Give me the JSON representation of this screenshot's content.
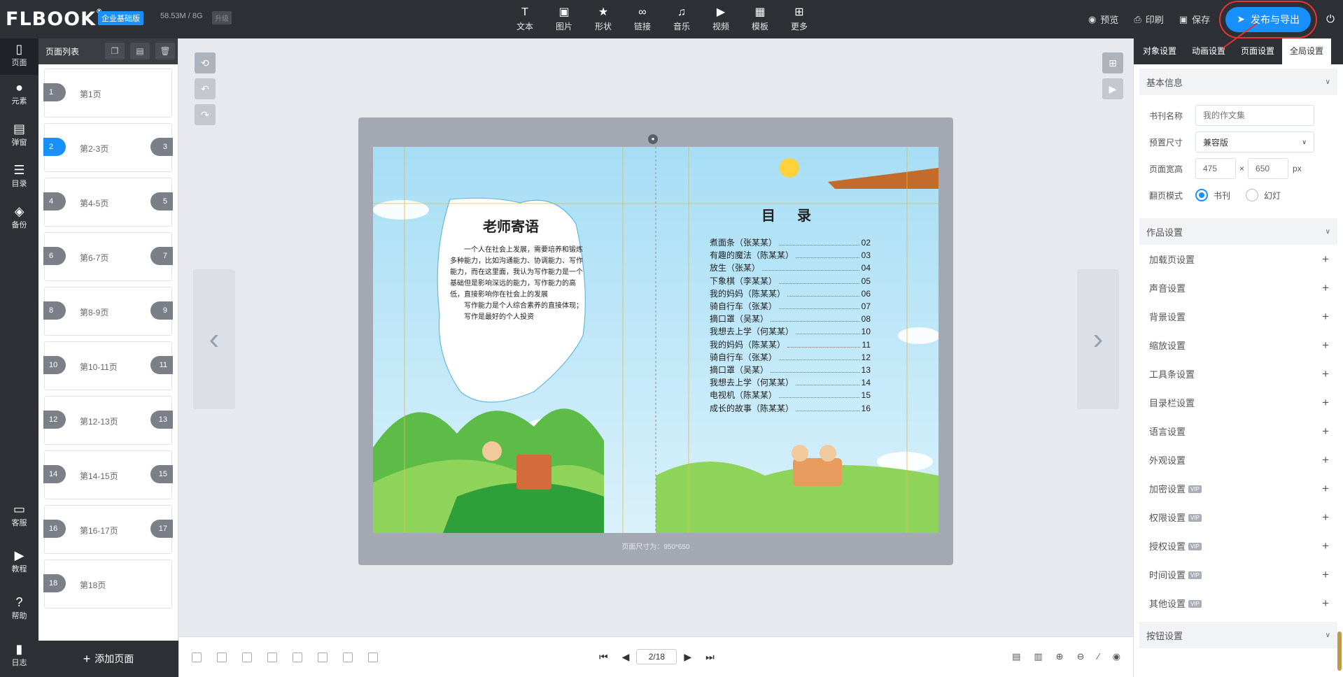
{
  "header": {
    "logo": "FLBOOK",
    "logo_mark": "®",
    "edition": "企业基础版",
    "storage": "58.53M / 8G",
    "upgrade": "升级",
    "tools": [
      {
        "icon": "T",
        "label": "文本",
        "name": "text-tool"
      },
      {
        "icon": "▣",
        "label": "图片",
        "name": "image-tool"
      },
      {
        "icon": "★",
        "label": "形状",
        "name": "shape-tool"
      },
      {
        "icon": "∞",
        "label": "链接",
        "name": "link-tool"
      },
      {
        "icon": "♫",
        "label": "音乐",
        "name": "music-tool"
      },
      {
        "icon": "▶",
        "label": "视频",
        "name": "video-tool"
      },
      {
        "icon": "▦",
        "label": "模板",
        "name": "template-tool"
      },
      {
        "icon": "⊞",
        "label": "更多",
        "name": "more-tool"
      }
    ],
    "preview": "预览",
    "print": "印刷",
    "save": "保存",
    "publish": "发布与导出"
  },
  "rail": [
    {
      "icon": "▯",
      "label": "页面"
    },
    {
      "icon": "●",
      "label": "元素"
    },
    {
      "icon": "▤",
      "label": "弹窗"
    },
    {
      "icon": "☰",
      "label": "目录"
    },
    {
      "icon": "◈",
      "label": "备份"
    },
    {
      "icon": "▭",
      "label": "客服"
    },
    {
      "icon": "▶",
      "label": "教程"
    },
    {
      "icon": "?",
      "label": "帮助"
    },
    {
      "icon": "▮",
      "label": "日志"
    }
  ],
  "page_list": {
    "title": "页面列表",
    "add_page": "添加页面",
    "pages": [
      {
        "left": "1",
        "right": "",
        "name": "第1页"
      },
      {
        "left": "2",
        "right": "3",
        "name": "第2-3页"
      },
      {
        "left": "4",
        "right": "5",
        "name": "第4-5页"
      },
      {
        "left": "6",
        "right": "7",
        "name": "第6-7页"
      },
      {
        "left": "8",
        "right": "9",
        "name": "第8-9页"
      },
      {
        "left": "10",
        "right": "11",
        "name": "第10-11页"
      },
      {
        "left": "12",
        "right": "13",
        "name": "第12-13页"
      },
      {
        "left": "14",
        "right": "15",
        "name": "第14-15页"
      },
      {
        "left": "16",
        "right": "17",
        "name": "第16-17页"
      },
      {
        "left": "18",
        "right": "",
        "name": "第18页"
      }
    ]
  },
  "canvas": {
    "page_size": "页面尺寸为：950*650",
    "left_page": {
      "title": "老师寄语",
      "paragraphs": [
        "一个人在社会上发展，需要培养和锻炼多种能力，比如沟通能力、协调能力、写作能力，而在这里面，我认为写作能力是一个基础但是影响深远的能力，写作能力的高低，直接影响你在社会上的发展",
        "写作能力是个人综合素养的直接体现；",
        "写作是最好的个人投资"
      ]
    },
    "right_page": {
      "title": "目 录",
      "toc": [
        {
          "item": "煮面条（张某某）",
          "page": "02"
        },
        {
          "item": "有趣的魔法（陈某某）",
          "page": "03"
        },
        {
          "item": "放生（张某）",
          "page": "04"
        },
        {
          "item": "下象棋（李某某）",
          "page": "05"
        },
        {
          "item": "我的妈妈（陈某某）",
          "page": "06"
        },
        {
          "item": "骑自行车（张某）",
          "page": "07"
        },
        {
          "item": "摘口罩（吴某）",
          "page": "08"
        },
        {
          "item": "我想去上学（何某某）",
          "page": "10"
        },
        {
          "item": "我的妈妈（陈某某）",
          "page": "11"
        },
        {
          "item": "骑自行车（张某）",
          "page": "12"
        },
        {
          "item": "摘口罩（吴某）",
          "page": "13"
        },
        {
          "item": "我想去上学（何某某）",
          "page": "14"
        },
        {
          "item": "电视机（陈某某）",
          "page": "15"
        },
        {
          "item": "成长的故事（陈某某）",
          "page": "16"
        }
      ]
    }
  },
  "pager": {
    "current": "2/18"
  },
  "right_panel": {
    "tabs": [
      "对象设置",
      "动画设置",
      "页面设置",
      "全局设置"
    ],
    "basic_info": "基本信息",
    "book_name_label": "书刊名称",
    "book_name_placeholder": "我的作文集",
    "preset_label": "预置尺寸",
    "preset_value": "兼容版",
    "size_label": "页面宽高",
    "width": "475",
    "height": "650",
    "times": "×",
    "unit": "px",
    "flip_label": "翻页模式",
    "flip_book": "书刊",
    "flip_slide": "幻灯",
    "work_settings": "作品设置",
    "items": [
      {
        "label": "加载页设置",
        "vip": ""
      },
      {
        "label": "声音设置",
        "vip": ""
      },
      {
        "label": "背景设置",
        "vip": ""
      },
      {
        "label": "缩放设置",
        "vip": ""
      },
      {
        "label": "工具条设置",
        "vip": ""
      },
      {
        "label": "目录栏设置",
        "vip": ""
      },
      {
        "label": "语言设置",
        "vip": ""
      },
      {
        "label": "外观设置",
        "vip": ""
      },
      {
        "label": "加密设置",
        "vip": "VIP"
      },
      {
        "label": "权限设置",
        "vip": "VIP"
      },
      {
        "label": "授权设置",
        "vip": "VIP"
      },
      {
        "label": "时间设置",
        "vip": "VIP"
      },
      {
        "label": "其他设置",
        "vip": "VIP"
      }
    ],
    "button_settings": "按钮设置"
  },
  "colors": {
    "accent": "#1890ff",
    "dark": "#2d3035",
    "highlight": "#e53333"
  }
}
